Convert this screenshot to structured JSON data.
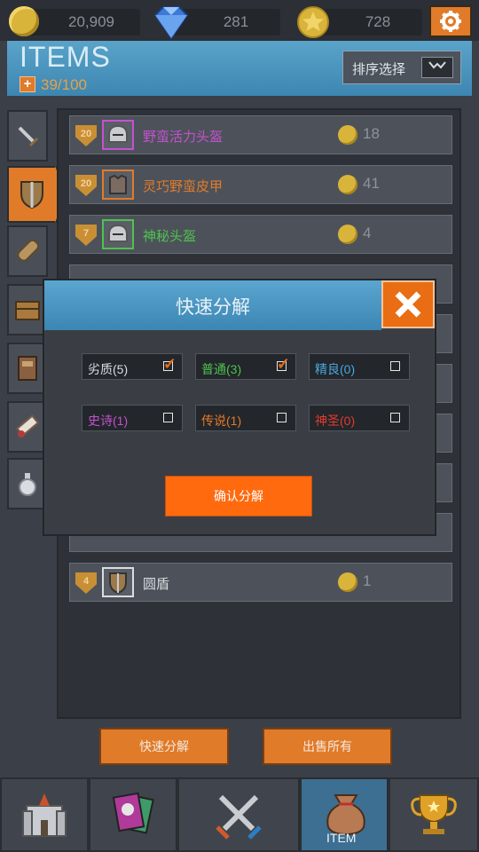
{
  "currency": {
    "gold": "20,909",
    "gems": "281",
    "medals": "728"
  },
  "header": {
    "title": "ITEMS",
    "capacity": "39/100",
    "sort_label": "排序选择"
  },
  "sidebar_tabs": [
    {
      "icon": "sword-icon"
    },
    {
      "icon": "shield-icon",
      "active": true
    },
    {
      "icon": "log-icon"
    },
    {
      "icon": "crate-icon"
    },
    {
      "icon": "book-icon"
    },
    {
      "icon": "scroll-icon"
    },
    {
      "icon": "potion-icon"
    }
  ],
  "items": [
    {
      "level": "20",
      "name": "野蛮活力头盔",
      "price": "18",
      "color": "#c451cf",
      "icon": "helmet-icon"
    },
    {
      "level": "20",
      "name": "灵巧野蛮皮甲",
      "price": "41",
      "color": "#e07b2a",
      "icon": "armor-icon"
    },
    {
      "level": "7",
      "name": "神秘头盔",
      "price": "4",
      "color": "#4fc24f",
      "icon": "helmet-icon"
    },
    {
      "level": "4",
      "name": "圆盾",
      "price": "1",
      "color": "#d9dce0",
      "icon": "round-shield-icon"
    }
  ],
  "buttons": {
    "quick_decompose": "快速分解",
    "sell_all": "出售所有"
  },
  "nav": {
    "item_label": "ITEM"
  },
  "dialog": {
    "title": "快速分解",
    "options": [
      {
        "label": "劣质(5)",
        "color": "#d9dce0",
        "checked": true
      },
      {
        "label": "普通(3)",
        "color": "#4fc24f",
        "checked": true
      },
      {
        "label": "精良(0)",
        "color": "#4aa7e0",
        "checked": false
      },
      {
        "label": "史诗(1)",
        "color": "#c451cf",
        "checked": false
      },
      {
        "label": "传说(1)",
        "color": "#e07b2a",
        "checked": false
      },
      {
        "label": "神圣(0)",
        "color": "#e23b2f",
        "checked": false
      }
    ],
    "confirm": "确认分解"
  }
}
